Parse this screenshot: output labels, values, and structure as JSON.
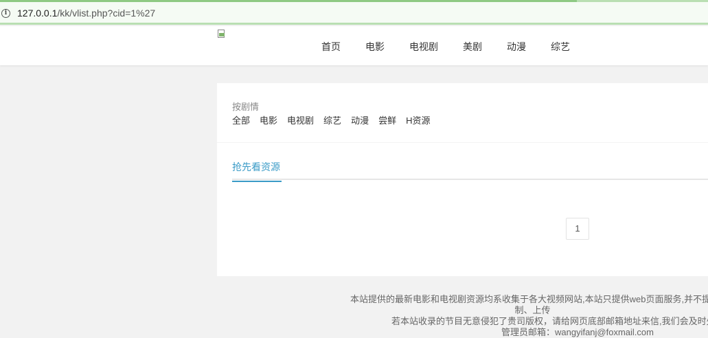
{
  "browser": {
    "url_host": "127.0.0.1",
    "url_path": "/kk/vlist.php?cid=1%27"
  },
  "header": {
    "nav": [
      "首页",
      "电影",
      "电视剧",
      "美剧",
      "动漫",
      "综艺"
    ]
  },
  "filter": {
    "label": "按剧情",
    "items": [
      "全部",
      "电影",
      "电视剧",
      "综艺",
      "动漫",
      "尝鲜",
      "H资源"
    ]
  },
  "tabs": {
    "active": "抢先看资源"
  },
  "pagination": {
    "current": "1"
  },
  "footer": {
    "line1": "本站提供的最新电影和电视剧资源均系收集于各大视频网站,本站只提供web页面服务,并不提供",
    "line2": "制、上传",
    "line3": "若本站收录的节目无意侵犯了贵司版权，请给网页底部邮箱地址来信,我们会及时处理",
    "line4": "管理员邮箱：wangyifanj@foxmail.com"
  },
  "colors": {
    "accent": "#3a9bc7",
    "page_bg": "#f2f2f2"
  }
}
